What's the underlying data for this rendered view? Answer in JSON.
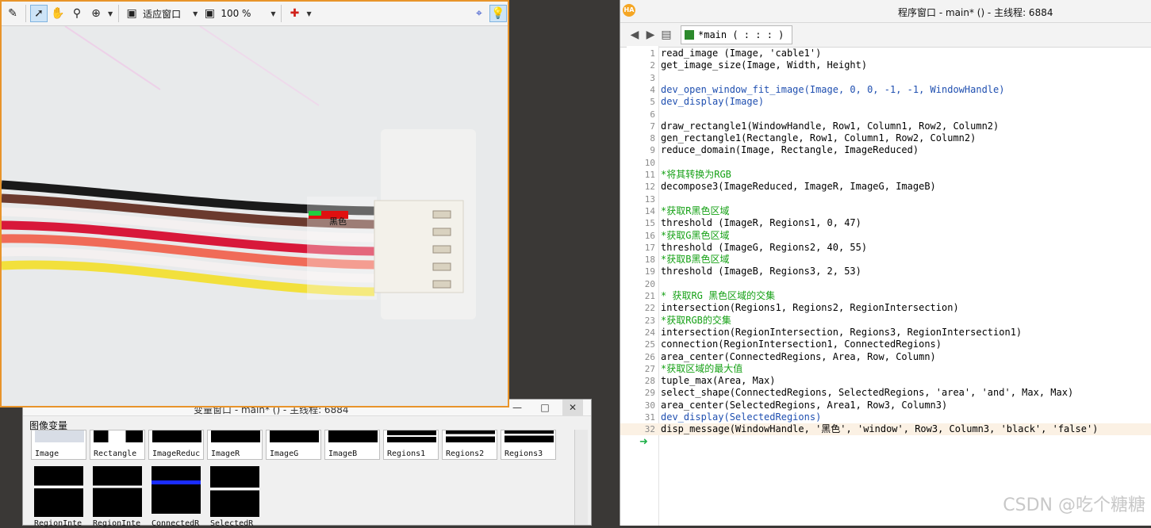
{
  "graphics_window": {
    "zoom_mode": "适应窗口",
    "zoom_percent": "100 %",
    "overlay_text": "黑色",
    "toolbar_icons": [
      "edit-icon",
      "pointer-icon",
      "hand-icon",
      "zoom-icon",
      "zoom-in-icon",
      "fit-window-icon",
      "zoom-percent-icon",
      "color-tool-icon",
      "inspect-icon",
      "lightbulb-icon"
    ],
    "wire_colors": [
      "#1a1a1a",
      "#6b3a2e",
      "#f4f0f0",
      "#d8183a",
      "#f06b58",
      "#f4f0f0",
      "#f2e03c"
    ]
  },
  "variable_window": {
    "title": "变量窗口 - main* () - 主线程: 6884",
    "section_label": "图像变量",
    "controls": [
      "—",
      "□",
      "✕"
    ],
    "thumbnails": [
      "Image",
      "Rectangle",
      "ImageReduc",
      "ImageR",
      "ImageG",
      "ImageB",
      "Regions1",
      "Regions2",
      "Regions3",
      "RegionInte",
      "RegionInte",
      "ConnectedR",
      "SelectedR"
    ]
  },
  "program_window": {
    "logo": "HA",
    "title": "程序窗口 - main* () - 主线程: 6884",
    "tab_label": "*main ( : : : )",
    "lines": [
      {
        "n": "1",
        "code": "read_image (Image, 'cable1')",
        "type": "code"
      },
      {
        "n": "2",
        "code": "get_image_size(Image, Width, Height)",
        "type": "code"
      },
      {
        "n": "3",
        "code": "",
        "type": "code"
      },
      {
        "n": "4",
        "code": "dev_open_window_fit_image(Image, 0, 0, -1, -1, WindowHandle)",
        "type": "op"
      },
      {
        "n": "5",
        "code": "dev_display(Image)",
        "type": "op"
      },
      {
        "n": "6",
        "code": "",
        "type": "code"
      },
      {
        "n": "7",
        "code": "draw_rectangle1(WindowHandle, Row1, Column1, Row2, Column2)",
        "type": "code"
      },
      {
        "n": "8",
        "code": "gen_rectangle1(Rectangle, Row1, Column1, Row2, Column2)",
        "type": "code"
      },
      {
        "n": "9",
        "code": "reduce_domain(Image, Rectangle, ImageReduced)",
        "type": "code"
      },
      {
        "n": "10",
        "code": "",
        "type": "code"
      },
      {
        "n": "11",
        "code": "*将其转换为RGB",
        "type": "comment"
      },
      {
        "n": "12",
        "code": "decompose3(ImageReduced, ImageR, ImageG, ImageB)",
        "type": "code"
      },
      {
        "n": "13",
        "code": "",
        "type": "code"
      },
      {
        "n": "14",
        "code": "*获取R黑色区域",
        "type": "comment"
      },
      {
        "n": "15",
        "code": "threshold (ImageR, Regions1, 0, 47)",
        "type": "code"
      },
      {
        "n": "16",
        "code": "*获取G黑色区域",
        "type": "comment"
      },
      {
        "n": "17",
        "code": "threshold (ImageG, Regions2, 40, 55)",
        "type": "code"
      },
      {
        "n": "18",
        "code": "*获取B黑色区域",
        "type": "comment"
      },
      {
        "n": "19",
        "code": "threshold (ImageB, Regions3, 2, 53)",
        "type": "code"
      },
      {
        "n": "20",
        "code": "",
        "type": "code"
      },
      {
        "n": "21",
        "code": "* 获取RG 黑色区域的交集",
        "type": "comment"
      },
      {
        "n": "22",
        "code": "intersection(Regions1, Regions2, RegionIntersection)",
        "type": "code"
      },
      {
        "n": "23",
        "code": "*获取RGB的交集",
        "type": "comment"
      },
      {
        "n": "24",
        "code": "intersection(RegionIntersection, Regions3, RegionIntersection1)",
        "type": "code"
      },
      {
        "n": "25",
        "code": "connection(RegionIntersection1, ConnectedRegions)",
        "type": "code"
      },
      {
        "n": "26",
        "code": "area_center(ConnectedRegions, Area, Row, Column)",
        "type": "code"
      },
      {
        "n": "27",
        "code": "*获取区域的最大值",
        "type": "comment"
      },
      {
        "n": "28",
        "code": "tuple_max(Area, Max)",
        "type": "code"
      },
      {
        "n": "29",
        "code": "select_shape(ConnectedRegions, SelectedRegions, 'area', 'and', Max, Max)",
        "type": "code"
      },
      {
        "n": "30",
        "code": "area_center(SelectedRegions, Area1, Row3, Column3)",
        "type": "code"
      },
      {
        "n": "31",
        "code": "dev_display(SelectedRegions)",
        "type": "op"
      },
      {
        "n": "32",
        "code": "disp_message(WindowHandle, '黑色', 'window', Row3, Column3, 'black', 'false')",
        "type": "current"
      }
    ]
  },
  "watermark": "CSDN @吃个糖糖"
}
